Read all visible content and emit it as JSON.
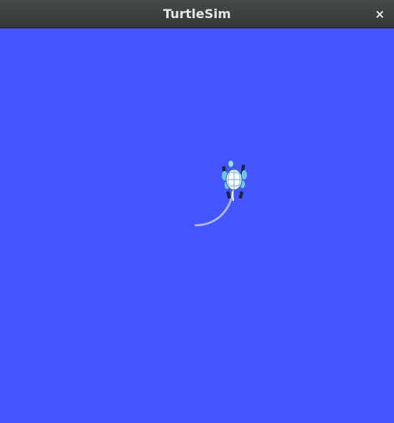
{
  "window": {
    "title": "TurtleSim",
    "close_glyph": "×",
    "close_icon": "close-icon"
  },
  "canvas": {
    "background_color": "#4556ff",
    "pen_color": "#b3b8ff"
  },
  "turtle": {
    "icon": "turtle-icon",
    "shell_color": "#ffffff",
    "flipper_color": "#6fc3ea",
    "foot_color": "#1c2340"
  }
}
